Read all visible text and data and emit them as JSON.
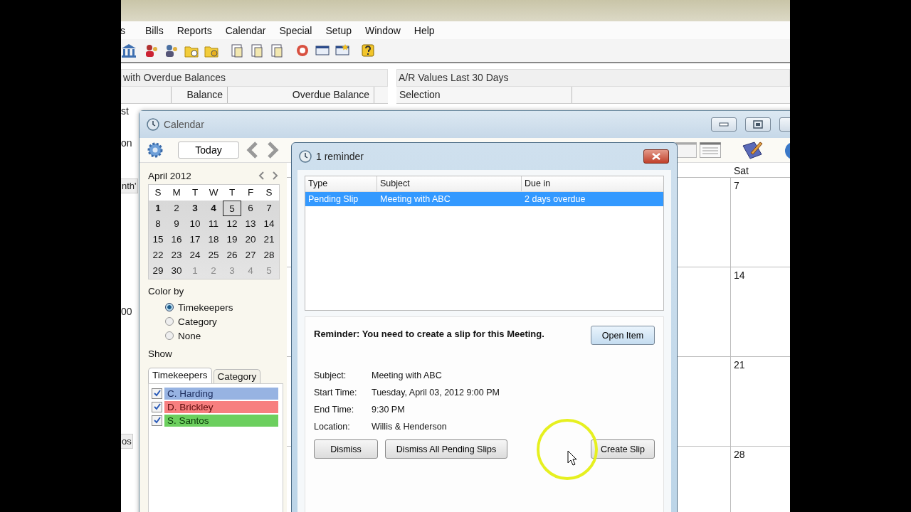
{
  "menu_bar": [
    "s",
    "Bills",
    "Reports",
    "Calendar",
    "Special",
    "Setup",
    "Window",
    "Help"
  ],
  "overdue_panel": {
    "title": "with Overdue Balances",
    "columns": [
      "Balance",
      "Overdue Balance"
    ]
  },
  "ar_panel": {
    "title": "A/R Values Last 30 Days",
    "columns": [
      "Selection"
    ]
  },
  "background_fragments": [
    "st",
    "on",
    "nth'",
    "00",
    "os"
  ],
  "calendar_window": {
    "title": "Calendar",
    "today_button": "Today",
    "mini_calendar": {
      "month": "April 2012",
      "weekdays": [
        "S",
        "M",
        "T",
        "W",
        "T",
        "F",
        "S"
      ],
      "weeks": [
        [
          {
            "day": "1",
            "bold": true,
            "today": false,
            "other_month": false
          },
          {
            "day": "2",
            "bold": false,
            "today": false,
            "other_month": false
          },
          {
            "day": "3",
            "bold": true,
            "today": false,
            "other_month": false
          },
          {
            "day": "4",
            "bold": true,
            "today": false,
            "other_month": false
          },
          {
            "day": "5",
            "bold": false,
            "today": true,
            "other_month": false
          },
          {
            "day": "6",
            "bold": false,
            "today": false,
            "other_month": false
          },
          {
            "day": "7",
            "bold": false,
            "today": false,
            "other_month": false
          }
        ],
        [
          {
            "day": "8",
            "bold": false,
            "today": false,
            "other_month": false
          },
          {
            "day": "9",
            "bold": false,
            "today": false,
            "other_month": false
          },
          {
            "day": "10",
            "bold": false,
            "today": false,
            "other_month": false
          },
          {
            "day": "11",
            "bold": false,
            "today": false,
            "other_month": false
          },
          {
            "day": "12",
            "bold": false,
            "today": false,
            "other_month": false
          },
          {
            "day": "13",
            "bold": false,
            "today": false,
            "other_month": false
          },
          {
            "day": "14",
            "bold": false,
            "today": false,
            "other_month": false
          }
        ],
        [
          {
            "day": "15",
            "bold": false,
            "today": false,
            "other_month": false
          },
          {
            "day": "16",
            "bold": false,
            "today": false,
            "other_month": false
          },
          {
            "day": "17",
            "bold": false,
            "today": false,
            "other_month": false
          },
          {
            "day": "18",
            "bold": false,
            "today": false,
            "other_month": false
          },
          {
            "day": "19",
            "bold": false,
            "today": false,
            "other_month": false
          },
          {
            "day": "20",
            "bold": false,
            "today": false,
            "other_month": false
          },
          {
            "day": "21",
            "bold": false,
            "today": false,
            "other_month": false
          }
        ],
        [
          {
            "day": "22",
            "bold": false,
            "today": false,
            "other_month": false
          },
          {
            "day": "23",
            "bold": false,
            "today": false,
            "other_month": false
          },
          {
            "day": "24",
            "bold": false,
            "today": false,
            "other_month": false
          },
          {
            "day": "25",
            "bold": false,
            "today": false,
            "other_month": false
          },
          {
            "day": "26",
            "bold": false,
            "today": false,
            "other_month": false
          },
          {
            "day": "27",
            "bold": false,
            "today": false,
            "other_month": false
          },
          {
            "day": "28",
            "bold": false,
            "today": false,
            "other_month": false
          }
        ],
        [
          {
            "day": "29",
            "bold": false,
            "today": false,
            "other_month": false
          },
          {
            "day": "30",
            "bold": false,
            "today": false,
            "other_month": false
          },
          {
            "day": "1",
            "bold": false,
            "today": false,
            "other_month": true
          },
          {
            "day": "2",
            "bold": false,
            "today": false,
            "other_month": true
          },
          {
            "day": "3",
            "bold": false,
            "today": false,
            "other_month": true
          },
          {
            "day": "4",
            "bold": false,
            "today": false,
            "other_month": true
          },
          {
            "day": "5",
            "bold": false,
            "today": false,
            "other_month": true
          }
        ]
      ]
    },
    "color_by": {
      "label": "Color by",
      "options": [
        {
          "label": "Timekeepers",
          "selected": true
        },
        {
          "label": "Category",
          "selected": false
        },
        {
          "label": "None",
          "selected": false
        }
      ]
    },
    "show": {
      "label": "Show",
      "tabs": [
        {
          "label": "Timekeepers",
          "selected": true
        },
        {
          "label": "Category",
          "selected": false
        }
      ],
      "items": [
        {
          "name": "C. Harding",
          "checked": true,
          "color": "#97b3e2"
        },
        {
          "name": "D. Brickley",
          "checked": true,
          "color": "#f77f7f"
        },
        {
          "name": "S. Santos",
          "checked": true,
          "color": "#6ccf5e"
        }
      ]
    },
    "month_view": {
      "header": "Sat",
      "days": [
        "7",
        "14",
        "21",
        "28"
      ]
    }
  },
  "reminder_dialog": {
    "title": "1 reminder",
    "columns": [
      "Type",
      "Subject",
      "Due in"
    ],
    "rows": [
      {
        "cells": [
          "Pending Slip",
          "Meeting with ABC",
          "2 days overdue"
        ],
        "selected": true
      }
    ],
    "message": "Reminder: You need to create a slip for this Meeting.",
    "open_button": "Open Item",
    "details": [
      {
        "label": "Subject:",
        "value": "Meeting with ABC"
      },
      {
        "label": "Start Time:",
        "value": "Tuesday, April 03, 2012 9:00 PM"
      },
      {
        "label": "End Time:",
        "value": "9:30 PM"
      },
      {
        "label": "Location:",
        "value": "Willis & Henderson"
      }
    ],
    "buttons": [
      "Dismiss",
      "Dismiss All Pending Slips"
    ],
    "create_button": "Create Slip"
  }
}
